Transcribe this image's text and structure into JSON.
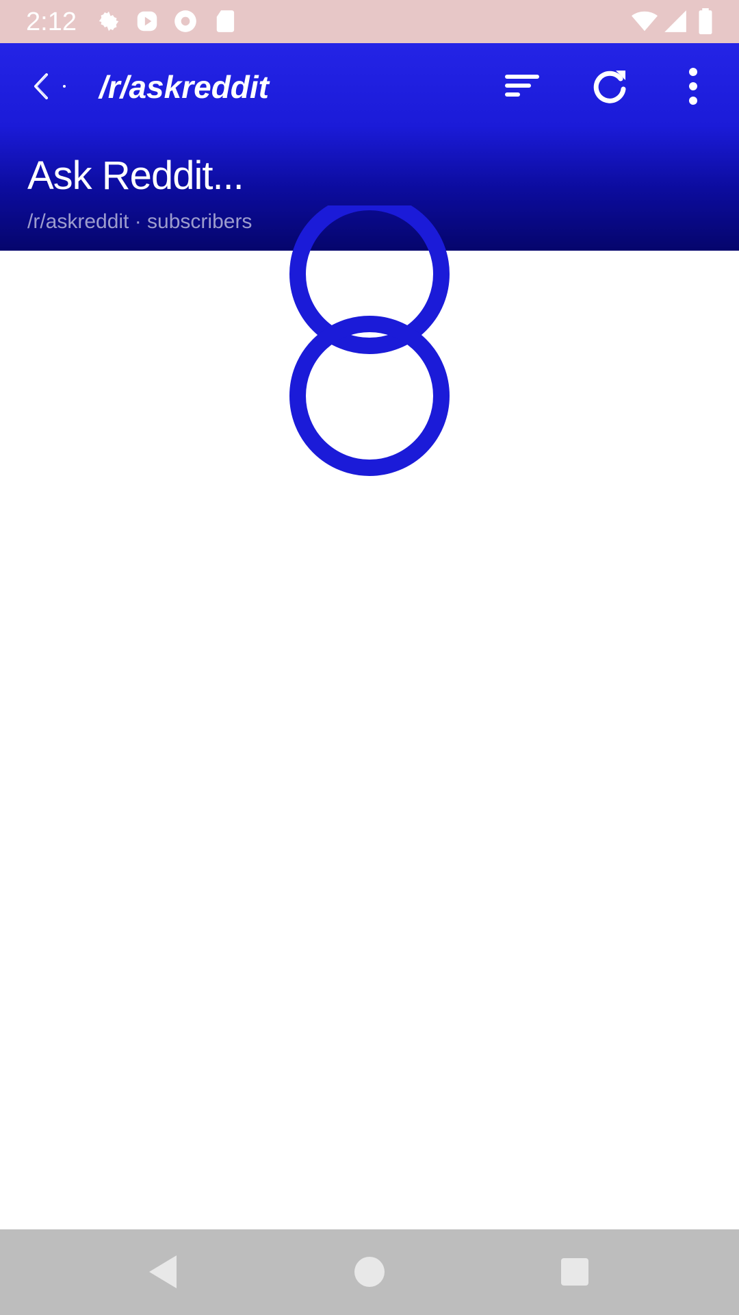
{
  "status_bar": {
    "time": "2:12",
    "left_icons": [
      "settings-icon",
      "play-store-icon",
      "chrome-icon",
      "sd-card-icon"
    ],
    "right_icons": [
      "wifi-icon",
      "signal-icon",
      "battery-icon"
    ],
    "background": "#e7c7c7"
  },
  "toolbar": {
    "title": "/r/askreddit",
    "back_icon": "back-arrow-icon",
    "actions": [
      "sort-icon",
      "refresh-icon",
      "more-vert-icon"
    ]
  },
  "header": {
    "subreddit_name": "Ask Reddit...",
    "subtitle": "/r/askreddit · subscribers",
    "accent": "#1b1bd8"
  },
  "loading": {
    "indicator": "loading-rings-icon",
    "color": "#1b1bd8"
  },
  "nav_bar": {
    "buttons": [
      "nav-back-icon",
      "nav-home-icon",
      "nav-recents-icon"
    ],
    "background": "#bdbdbd"
  }
}
